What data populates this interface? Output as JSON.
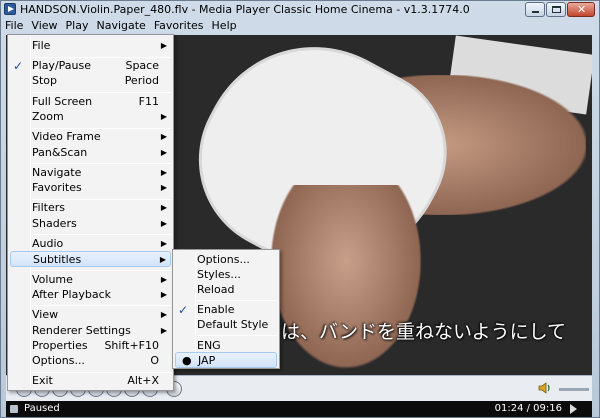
{
  "window": {
    "title": "HANDSON.Violin.Paper_480.flv - Media Player Classic Home Cinema - v1.3.1774.0"
  },
  "menubar": [
    "File",
    "View",
    "Play",
    "Navigate",
    "Favorites",
    "Help"
  ],
  "video": {
    "subtitle": "は、バンドを重ねないようにして"
  },
  "status": {
    "state": "Paused",
    "time": "01:24 / 09:16"
  },
  "context_menu": {
    "items": [
      {
        "label": "File",
        "submenu": true
      },
      {
        "label": "Play/Pause",
        "shortcut": "Space",
        "checked": true
      },
      {
        "label": "Stop",
        "shortcut": "Period"
      },
      {
        "label": "Full Screen",
        "shortcut": "F11"
      },
      {
        "label": "Zoom",
        "submenu": true
      },
      {
        "label": "Video Frame",
        "submenu": true
      },
      {
        "label": "Pan&Scan",
        "submenu": true
      },
      {
        "label": "Navigate",
        "submenu": true
      },
      {
        "label": "Favorites",
        "submenu": true
      },
      {
        "label": "Filters",
        "submenu": true
      },
      {
        "label": "Shaders",
        "submenu": true
      },
      {
        "label": "Audio",
        "submenu": true
      },
      {
        "label": "Subtitles",
        "submenu": true,
        "highlighted": true
      },
      {
        "label": "Volume",
        "submenu": true
      },
      {
        "label": "After Playback",
        "submenu": true
      },
      {
        "label": "View",
        "submenu": true
      },
      {
        "label": "Renderer Settings",
        "submenu": true
      },
      {
        "label": "Properties",
        "shortcut": "Shift+F10"
      },
      {
        "label": "Options...",
        "shortcut": "O"
      },
      {
        "label": "Exit",
        "shortcut": "Alt+X"
      }
    ]
  },
  "subtitles_menu": {
    "items": [
      {
        "label": "Options..."
      },
      {
        "label": "Styles..."
      },
      {
        "label": "Reload"
      },
      {
        "label": "Enable",
        "checked": true
      },
      {
        "label": "Default Style"
      },
      {
        "label": "ENG"
      },
      {
        "label": "JAP",
        "selected": true
      }
    ]
  }
}
